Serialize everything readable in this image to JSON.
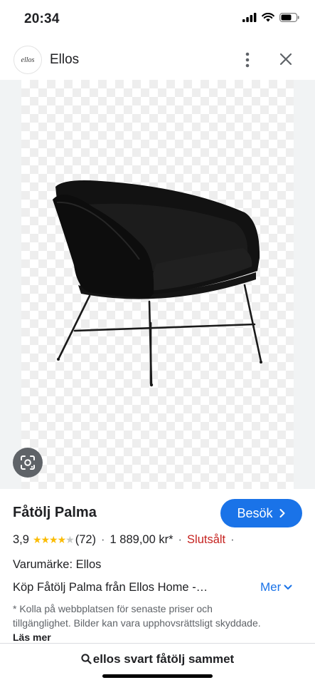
{
  "status_bar": {
    "time": "20:34"
  },
  "header": {
    "logo_text": "ellos",
    "site_name": "Ellos"
  },
  "product": {
    "title": "Fåtölj Palma",
    "visit_label": "Besök",
    "rating": "3,9",
    "rating_value": 3.9,
    "review_count": "(72)",
    "price": "1 889,00 kr*",
    "availability": "Slutsålt",
    "brand_line": "Varumärke: Ellos",
    "description": "Köp Fåtölj Palma från Ellos Home -…",
    "more_label": "Mer",
    "disclaimer": "* Kolla på webbplatsen för senaste priser och tillgänglighet. Bilder kan vara upphovsrättsligt skyddade.",
    "read_more": "Läs mer"
  },
  "search_bar": {
    "query": "ellos svart fåtölj sammet"
  },
  "colors": {
    "accent": "#1a73e8",
    "sold_out": "#c5221f",
    "star": "#fbbc04"
  }
}
